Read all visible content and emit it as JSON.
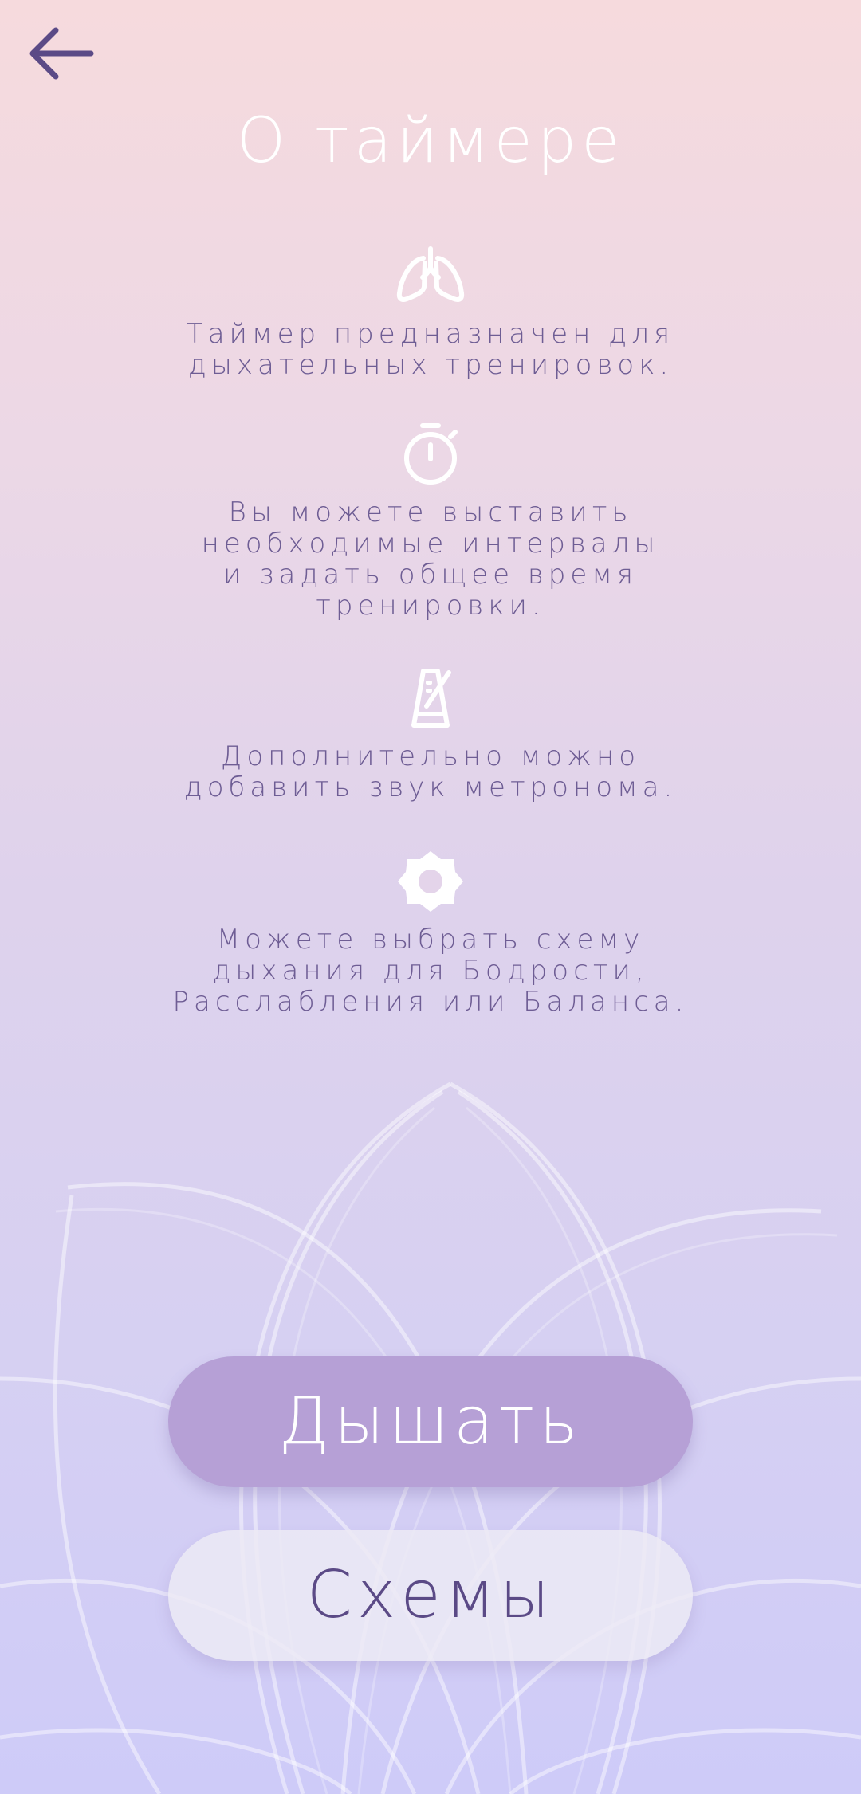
{
  "header": {
    "back_icon": "arrow-left-icon",
    "title": "О таймере"
  },
  "features": [
    {
      "icon": "lungs-icon",
      "text": "Таймер предназначен для\nдыхательных тренировок."
    },
    {
      "icon": "stopwatch-icon",
      "text": "Вы можете выставить\nнеобходимые интервалы\nи задать общее время\nтренировки."
    },
    {
      "icon": "metronome-icon",
      "text": "Дополнительно можно\nдобавить звук метронома."
    },
    {
      "icon": "sun-gear-icon",
      "text": "Можете выбрать схему\nдыхания для Бодрости,\nРасслабления или Баланса."
    }
  ],
  "buttons": {
    "breathe_label": "Дышать",
    "schemes_label": "Схемы"
  },
  "colors": {
    "accent": "#b6a0d6",
    "text_purple": "#6e5d94",
    "back_arrow": "#5b4a86"
  }
}
